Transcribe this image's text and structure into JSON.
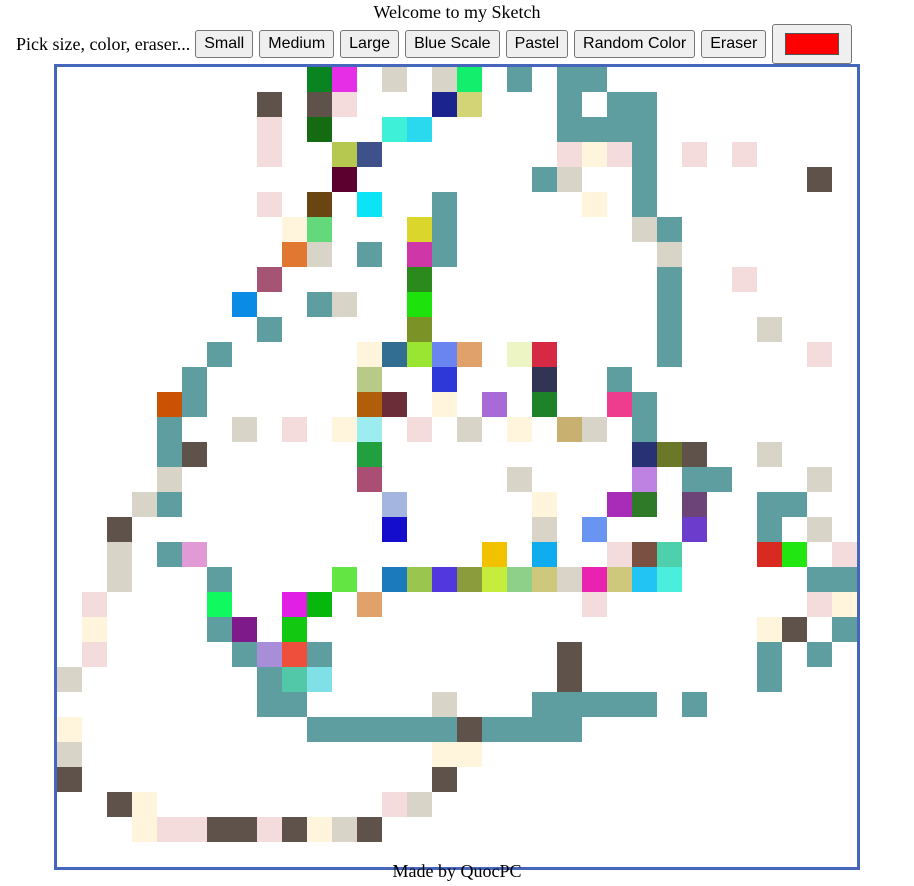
{
  "header": {
    "title": "Welcome to my Sketch"
  },
  "toolbar": {
    "prompt": "Pick size, color, eraser...",
    "buttons": {
      "small": "Small",
      "medium": "Medium",
      "large": "Large",
      "blue_scale": "Blue Scale",
      "pastel": "Pastel",
      "random_color": "Random Color",
      "eraser": "Eraser"
    },
    "color_picker_value": "#ff0000"
  },
  "footer": {
    "credit": "Made by QuocPC"
  },
  "sketch": {
    "grid_size": 32,
    "colors": {
      "T": "#5f9ea0",
      "D": "#5e524b",
      "P": "#f5dcdc",
      "C": "#fff5dc",
      "G": "#d8d5c8",
      "a": "#088520",
      "b": "#e62ee6",
      "c": "#13ef6c",
      "d": "#1a238e",
      "e": "#d2d476",
      "f": "#156b12",
      "g": "#3ef0d8",
      "h": "#2ad9ee",
      "i": "#b6c850",
      "j": "#3f518a",
      "k": "#5c0030",
      "l": "#6a4512",
      "m": "#0ae4f4",
      "n": "#63d97c",
      "o": "#dbd62c",
      "p": "#e07832",
      "q": "#cf36a8",
      "r": "#a65474",
      "s": "#2a8a1c",
      "t": "#0a8ce6",
      "u": "#1ee20c",
      "v": "#7a9226",
      "w": "#326e92",
      "x": "#9ae432",
      "y": "#6a84f0",
      "z": "#e0a26a",
      "A": "#eef5c4",
      "B": "#d62a44",
      "E": "#2d3c9e",
      "F": "#b8ca88",
      "H": "#2e38d8",
      "I": "#313553",
      "J": "#cc5203",
      "K": "#b05e0a",
      "L": "#6b2e38",
      "M": "#a76ad6",
      "N": "#1e8228",
      "O": "#ee3c8e",
      "Q": "#9cecf0",
      "R": "#c8b070",
      "S": "#263274",
      "U": "#6a7828",
      "V": "#22a040",
      "W": "#aa4e74",
      "X": "#be82e2",
      "Y": "#a4b6e0",
      "Z": "#2e7a28",
      "0": "#a82cb8",
      "1": "#6c4478",
      "2": "#140ecc",
      "3": "#6a94f2",
      "4": "#6c3ccc",
      "5": "#e29ad6",
      "6": "#f2c200",
      "7": "#10acf0",
      "8": "#7a5042",
      "9": "#4ed0ac",
      "!": "#d92a22",
      "@": "#22e610",
      "#": "#1a7abc",
      "$": "#9ac650",
      "%": "#5236de",
      "^": "#8a9c3c",
      "&": "#c6ec3c",
      "*": "#8ed08a",
      "(": "#ea22b2",
      ")": "#cec87c",
      "-": "#22c4f4",
      "+": "#4aeedc",
      "=": "#62e644",
      "~": "#10fa60",
      "`": "#e020e4",
      "[": "#06b80c",
      "]": "#8ee8b0",
      "{": "#7e1a8a",
      "}": "#12c810",
      "<": "#a88ed8",
      ">": "#ee4e3c",
      "?": "#52c8a8",
      "|": "#80e0e8"
    },
    "rows": [
      "..........ab.G.Gc.T.TT..........",
      "........D.DP...de...T.TT........",
      "........P.f..gh.....TTTT........",
      "........P..ij.......PCPT.P.P....",
      "...........k.......TG..T......D.",
      "........P.l.m..T.....C.T........",
      ".........Cn...oT.......GT........",
      ".........pG.T.qT........G.......",
      "........r.....s.........T..P....",
      ".......t..TG..u.........T.......",
      "........T.....v.........T...G...",
      "......T.....Cwxyz.AB....T.....P.",
      ".....T......F..H...I..T.........",
      "....JT......KL.C.M.N..OT........",
      "....T..G.P.CQ.P.G.C.RG.T........",
      "....TD......V..........SUD..G...",
      "....G.......W.....G....X.TT...G.",
      "...GT........Y.....C..0Z.1..TT..",
      "..D..........2.....G.3...4..T.G.",
      "..G.T5...........6.7..P89...!@.PT.",
      "..G...T....=.#$%^&*)G()-+.....TT",
      ".P....~..`[.z........P........PC.GC",
      ".C....T{.}..................CD.T",
      ".P.....T<>T.........D.......T.T.",
      "G.......T?|.........D.......T...",
      "........TT.....G...TTTTT.T......",
      "C.........TTTTTTDTTTT...........",
      "G..............CC...............",
      "D..............D................",
      "..DC.........PG.................",
      "...CPPDDPDCGD...................",
      "................................"
    ]
  }
}
